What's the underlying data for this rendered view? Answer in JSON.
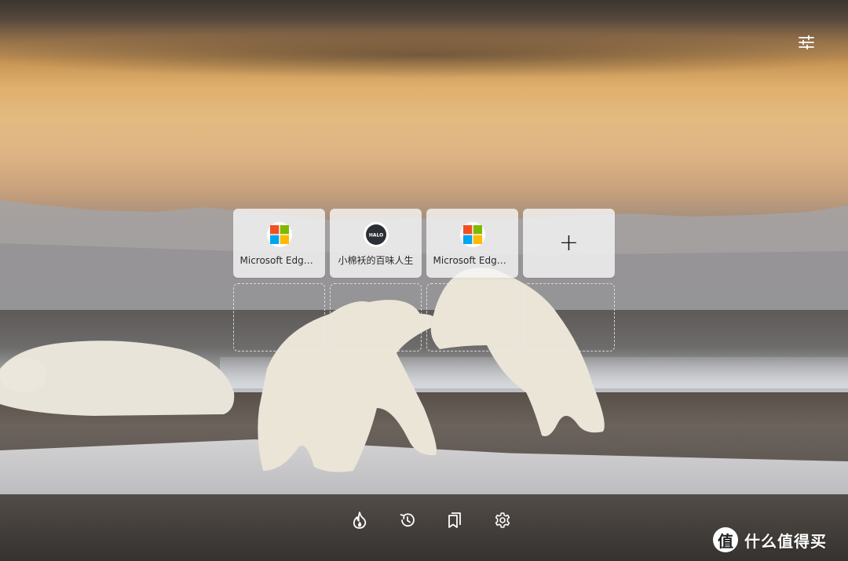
{
  "speed_dial": {
    "tiles": [
      {
        "label": "Microsoft Edge ...",
        "icon": "microsoft-logo-icon"
      },
      {
        "label": "小棉袄的百味人生",
        "icon": "halo-logo-icon",
        "logo_text": "HALO"
      },
      {
        "label": "Microsoft Edge ...",
        "icon": "microsoft-logo-icon"
      },
      {
        "label": "+",
        "icon": "add-icon"
      }
    ],
    "empty_slots": 4
  },
  "settings": {
    "icon": "sliders-icon"
  },
  "toolbar": {
    "items": [
      {
        "icon": "flame-icon"
      },
      {
        "icon": "history-icon"
      },
      {
        "icon": "bookmarks-icon"
      },
      {
        "icon": "gear-icon"
      }
    ]
  },
  "watermark": {
    "logo": "值",
    "text": "什么值得买"
  },
  "colors": {
    "ms_red": "#f25022",
    "ms_green": "#7fba00",
    "ms_blue": "#00a4ef",
    "ms_yellow": "#ffb900",
    "tile_bg": "#f5f5f5",
    "icon_fg": "#ffffff"
  }
}
